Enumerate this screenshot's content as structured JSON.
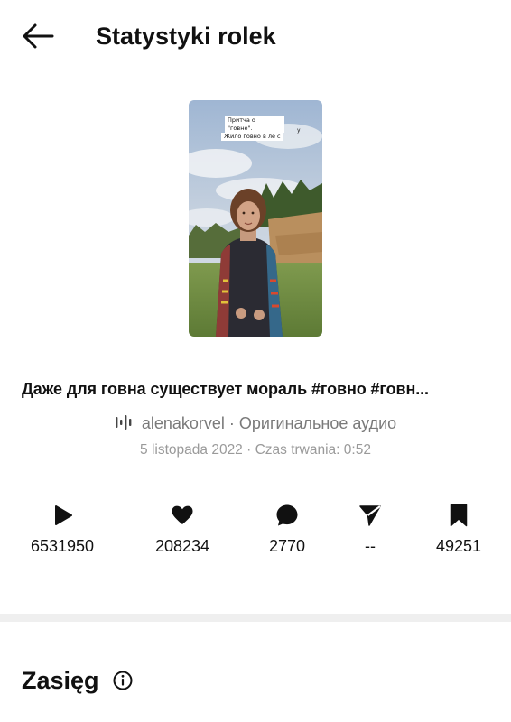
{
  "header": {
    "title": "Statystyki rolek",
    "back_icon": "arrow-left-icon"
  },
  "reel": {
    "thumbnail": {
      "caption_line1": "Притча о \"говне\".",
      "caption_line2": "Жило говно в ле с",
      "caption_stray": "у"
    },
    "description": "Даже для говна существует мораль #говно #говн...",
    "audio": {
      "icon": "audio-waveform-icon",
      "text": "alenakorvel · Оригинальное аудио"
    },
    "meta": "5 listopada 2022 · Czas trwania: 0:52"
  },
  "stats": [
    {
      "name": "plays",
      "icon": "play-icon",
      "value": "6531950"
    },
    {
      "name": "likes",
      "icon": "heart-icon",
      "value": "208234"
    },
    {
      "name": "comments",
      "icon": "comment-icon",
      "value": "2770"
    },
    {
      "name": "shares",
      "icon": "send-icon",
      "value": "--"
    },
    {
      "name": "saves",
      "icon": "bookmark-icon",
      "value": "49251"
    }
  ],
  "section": {
    "title": "Zasięg",
    "info_icon": "info-icon"
  },
  "colors": {
    "text": "#111111",
    "secondary_text": "#7a7a7a",
    "divider": "#efefef"
  }
}
